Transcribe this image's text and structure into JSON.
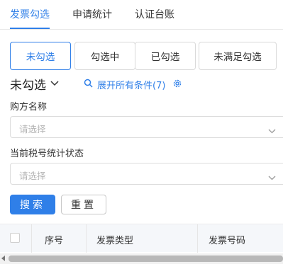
{
  "tabs": [
    {
      "label": "发票勾选",
      "active": true
    },
    {
      "label": "申请统计",
      "active": false
    },
    {
      "label": "认证台账",
      "active": false
    }
  ],
  "filters": [
    {
      "label": "未勾选",
      "active": true
    },
    {
      "label": "勾选中",
      "active": false
    },
    {
      "label": "已勾选",
      "active": false
    },
    {
      "label": "未满足勾选",
      "active": false
    }
  ],
  "status": {
    "title": "未勾选"
  },
  "expand_link": "展开所有条件(7)",
  "buyer": {
    "label": "购方名称",
    "placeholder": "请选择"
  },
  "tax_status": {
    "label": "当前税号统计状态",
    "placeholder": "请选择"
  },
  "buttons": {
    "search": "搜索",
    "reset": "重置"
  },
  "table": {
    "columns": [
      "序号",
      "发票类型",
      "发票号码"
    ]
  },
  "icons": [
    "chevron-down-icon",
    "search-icon",
    "gear-icon",
    "checkbox-icon",
    "scroll-left-icon"
  ],
  "colors": {
    "accent": "#2f7fe8",
    "border": "#d9d9d9",
    "header_bg": "#f5f7fa"
  }
}
